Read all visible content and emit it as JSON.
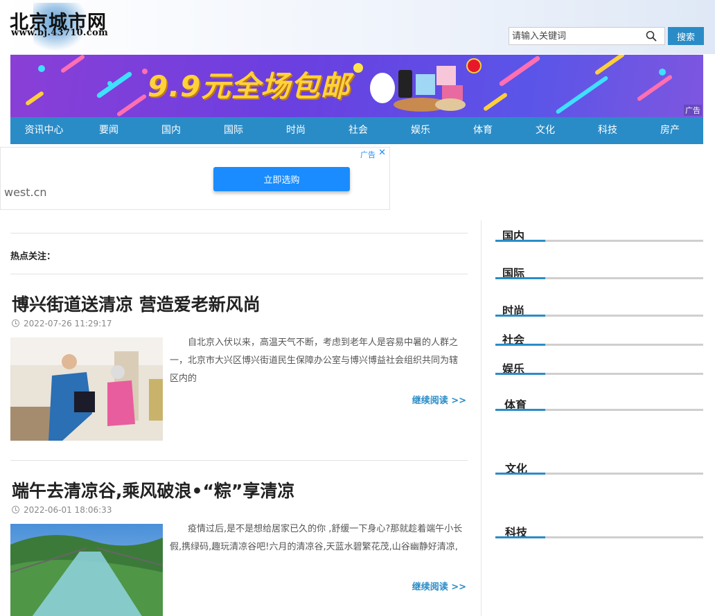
{
  "site": {
    "logo_title": "北京城市网",
    "logo_url": "www.bj.43710.com"
  },
  "search": {
    "placeholder": "请输入关键词",
    "button_label": "搜索"
  },
  "banner": {
    "headline": "9.9元全场包邮",
    "ad_label": "广告"
  },
  "nav": {
    "items": [
      "资讯中心",
      "要闻",
      "国内",
      "国际",
      "时尚",
      "社会",
      "娱乐",
      "体育",
      "文化",
      "科技",
      "房产"
    ]
  },
  "ad_block": {
    "domain": "west.cn",
    "button_label": "立即选购",
    "ad_label": "广告",
    "close": "✕"
  },
  "main": {
    "hot_label": "热点关注：",
    "articles": [
      {
        "title": "博兴街道送清凉 营造爱老新风尚",
        "date": "2022-07-26 11:29:17",
        "excerpt": "自北京入伏以来，高温天气不断，考虑到老年人是容易中暑的人群之一，北京市大兴区博兴街道民生保障办公室与博兴博益社会组织共同为辖区内的",
        "more": "继续阅读 >>"
      },
      {
        "title": "端午去清凉谷,乘风破浪•“粽”享清凉",
        "date": "2022-06-01 18:06:33",
        "excerpt": "疫情过后,是不是想给居家已久的你 ,舒缓一下身心?那就趁着端午小长假,携绿码,趣玩清凉谷吧!六月的清凉谷,天蓝水碧繁花茂,山谷幽静好清凉,",
        "more": "继续阅读 >>"
      }
    ]
  },
  "sidebar": {
    "items": [
      "国内",
      "国际",
      "时尚",
      "社会",
      "娱乐",
      "体育",
      "文化",
      "科技"
    ]
  },
  "colors": {
    "accent": "#2a8cc7",
    "ad_button": "#1a8cff",
    "banner_text": "#ffd23a"
  }
}
